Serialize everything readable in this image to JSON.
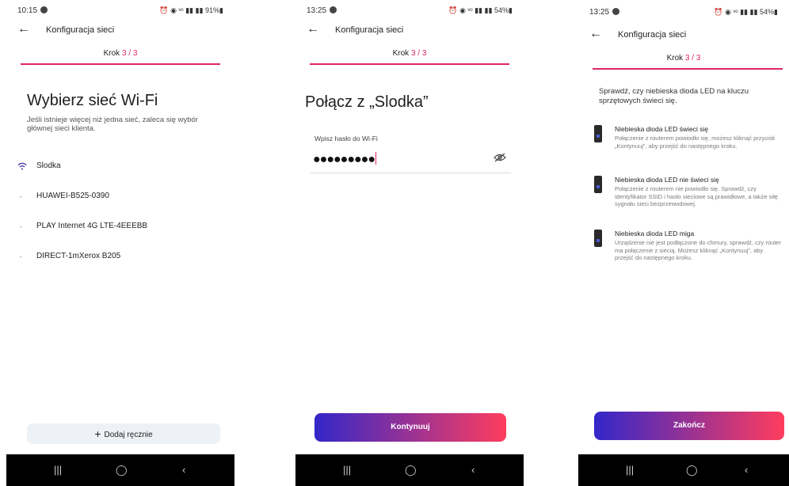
{
  "common": {
    "app_title": "Konfiguracja sieci",
    "step_label": "Krok",
    "step_value": "3 / 3",
    "accent": "#e0275e"
  },
  "screen1": {
    "time": "10:15",
    "status_icons": "⏰ ◉ ᵛᵒ ▮▮ ▮▮ 91%▮",
    "heading": "Wybierz sieć Wi-Fi",
    "description": "Jeśli istnieje więcej niż jedna sieć, zaleca się wybór głównej sieci klienta.",
    "networks": [
      {
        "name": "Slodka",
        "icon": "wifi-icon"
      },
      {
        "name": "HUAWEI-B525-0390",
        "icon": "wifi-weak-icon"
      },
      {
        "name": "PLAY Internet 4G LTE-4EEEBB",
        "icon": "wifi-weak-icon"
      },
      {
        "name": "DIRECT-1mXerox B205",
        "icon": "wifi-weak-icon"
      }
    ],
    "add_button": "Dodaj ręcznie"
  },
  "screen2": {
    "time": "13:25",
    "status_icons": "⏰ ◉ ᵛᵒ ▮▮ ▮▮ 54%▮",
    "heading": "Połącz z „Slodka”",
    "password_label": "Wpisz hasło do Wi-Fi",
    "password_value": "●●●●●●●●●",
    "continue_button": "Kontynuuj"
  },
  "screen3": {
    "time": "13:25",
    "status_icons": "⏰ ◉ ᵛᵒ ▮▮ ▮▮ 54%▮",
    "intro": "Sprawdź, czy niebieska dioda LED na kluczu sprzętowych świeci się.",
    "items": [
      {
        "title": "Niebieska dioda LED świeci się",
        "text": "Połączenie z routerem powiodło się, możesz kliknąć przycisk „Kontynuuj”, aby przejść do następnego kroku."
      },
      {
        "title": "Niebieska dioda LED nie świeci się",
        "text": "Połączenie z routerem nie powiodło się. Sprawdź, czy identyfikator SSID i hasło sieciowe są prawidłowe, a także siłę sygnału sieci bezprzewodowej."
      },
      {
        "title": "Niebieska dioda LED miga",
        "text": "Urządzenie nie jest podłączone do chmury, sprawdź, czy router ma połączenie z siecią. Możesz kliknąć „Kontynuuj”, aby przejść do następnego kroku."
      }
    ],
    "finish_button": "Zakończ"
  },
  "navbar": {
    "recent": "|||",
    "home": "◯",
    "back": "‹"
  }
}
